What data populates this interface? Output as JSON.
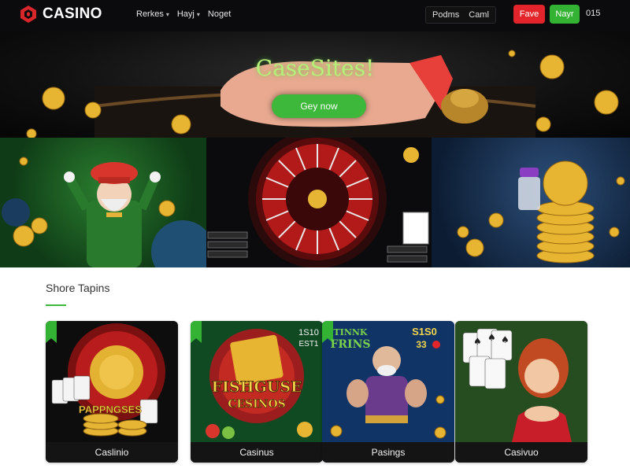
{
  "header": {
    "logo_text": "CASINO",
    "nav": [
      {
        "label": "Rerkes"
      },
      {
        "label": "Hayj"
      },
      {
        "label": "Noget"
      }
    ],
    "auth": {
      "login": "Podms",
      "register": "Caml"
    },
    "red_button": "Fave",
    "green_button": "Nayr",
    "counter": "015"
  },
  "hero": {
    "title": "CaseSites!",
    "cta": "Gey now"
  },
  "section": {
    "title": "Shore Tapins"
  },
  "cards": [
    {
      "label": "Caslinio",
      "art_text": "PAPPNGSES"
    },
    {
      "label": "Casinus",
      "art_text_1": "FISHGUSE",
      "art_text_2": "CESINOS",
      "badge_1": "1S10",
      "badge_2": "EST1"
    },
    {
      "label": "Pasings",
      "art_text_1": "TINNK",
      "art_text_2": "FRINS",
      "badge_1": "S1S0",
      "badge_2": "33"
    },
    {
      "label": "Casivuo"
    }
  ],
  "colors": {
    "accent_green": "#3db83a",
    "accent_red": "#e3252b",
    "dark": "#0b0b0d"
  }
}
